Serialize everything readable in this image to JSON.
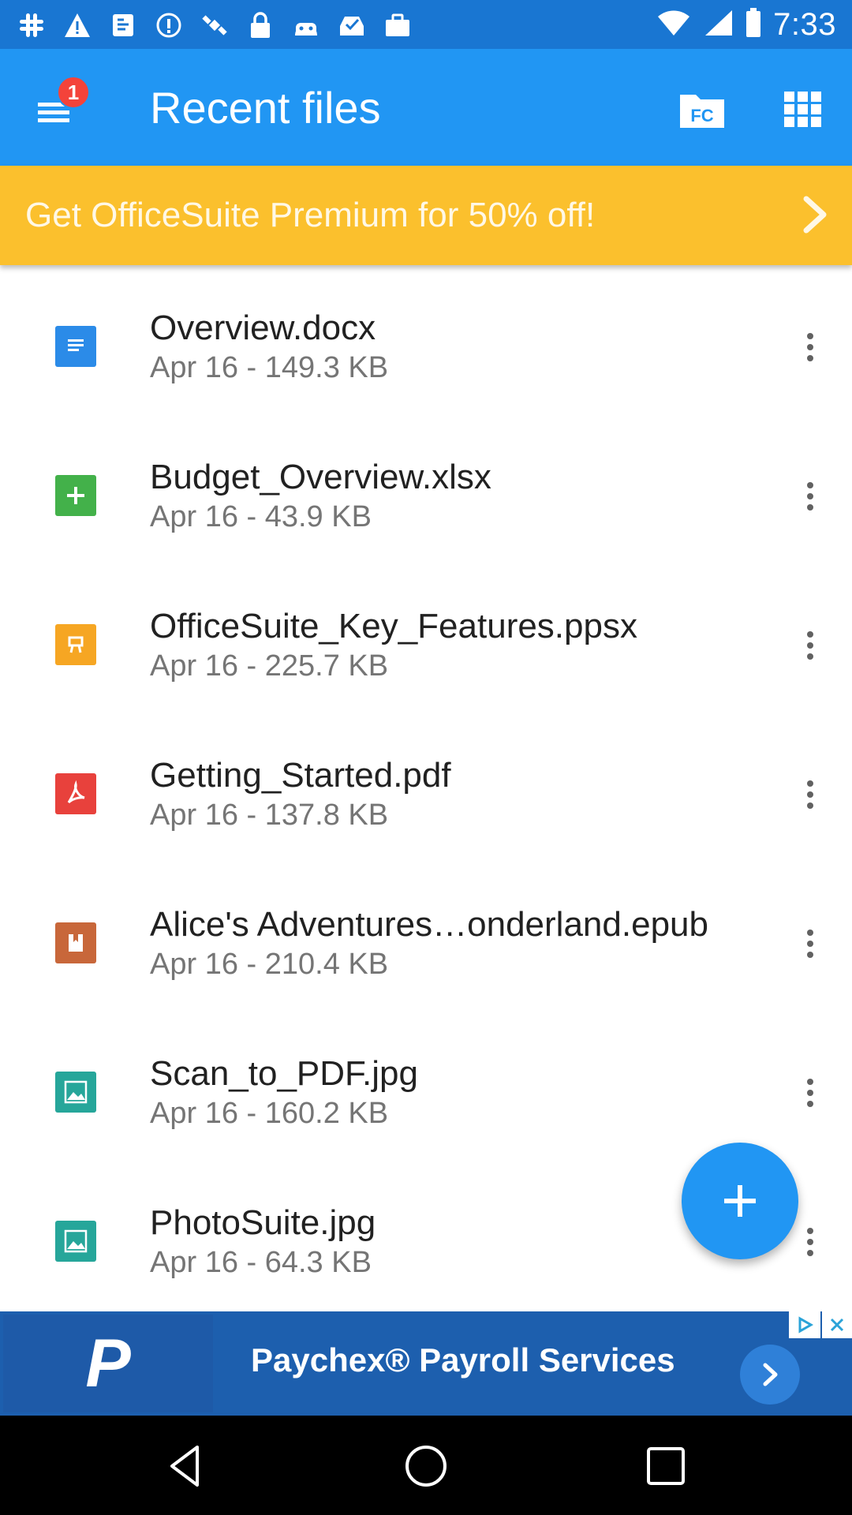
{
  "status_bar": {
    "time": "7:33",
    "icons": [
      "slack-icon",
      "warning-icon",
      "sim-toolkit-icon",
      "info-icon",
      "satellite-icon",
      "lock-icon",
      "android-icon",
      "inbox-check-icon",
      "briefcase-icon",
      "wifi-icon",
      "signal-icon",
      "battery-icon"
    ]
  },
  "app_bar": {
    "title": "Recent files",
    "notification_count": "1"
  },
  "promo": {
    "text": "Get OfficeSuite Premium for 50% off!"
  },
  "files": [
    {
      "name": "Overview.docx",
      "meta": "Apr 16 - 149.3 KB",
      "type": "docx",
      "color": "#2b8be8"
    },
    {
      "name": "Budget_Overview.xlsx",
      "meta": "Apr 16 - 43.9 KB",
      "type": "xlsx",
      "color": "#43b14a"
    },
    {
      "name": "OfficeSuite_Key_Features.ppsx",
      "meta": "Apr 16 - 225.7 KB",
      "type": "ppsx",
      "color": "#f6a623"
    },
    {
      "name": "Getting_Started.pdf",
      "meta": "Apr 16 - 137.8 KB",
      "type": "pdf",
      "color": "#e8413c"
    },
    {
      "name": "Alice's Adventures…onderland.epub",
      "meta": "Apr 16 - 210.4 KB",
      "type": "epub",
      "color": "#c8673a"
    },
    {
      "name": "Scan_to_PDF.jpg",
      "meta": "Apr 16 - 160.2 KB",
      "type": "image",
      "color": "#26a69a"
    },
    {
      "name": "PhotoSuite.jpg",
      "meta": "Apr 16 - 64.3 KB",
      "type": "image",
      "color": "#26a69a"
    }
  ],
  "ad": {
    "logo_letter": "P",
    "text": "Paychex® Payroll Services"
  },
  "colors": {
    "status_bar": "#1976d2",
    "app_bar": "#2196f3",
    "promo": "#fbc02d",
    "fab": "#2196f3"
  }
}
